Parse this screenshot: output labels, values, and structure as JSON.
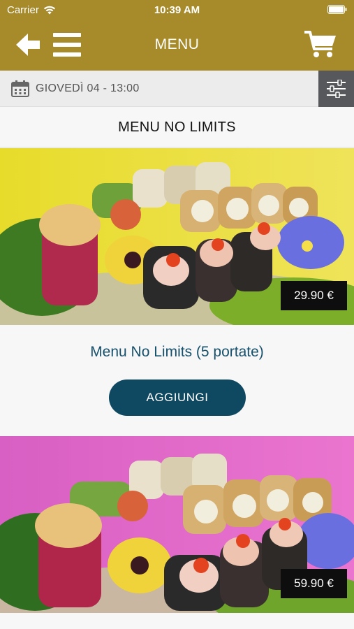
{
  "status_bar": {
    "carrier": "Carrier",
    "time": "10:39 AM"
  },
  "nav": {
    "title": "MENU"
  },
  "date_bar": {
    "label": "GIOVEDÌ 04 - 13:00"
  },
  "section": {
    "title": "MENU NO LIMITS"
  },
  "products": [
    {
      "price": "29.90 €",
      "name": "Menu No Limits (5 portate)",
      "button": "AGGIUNGI",
      "background": "yellow"
    },
    {
      "price": "59.90 €",
      "background": "pink"
    }
  ],
  "colors": {
    "brand_gold": "#a78a2a",
    "accent_blue": "#0f4861",
    "product_text": "#17506b"
  }
}
